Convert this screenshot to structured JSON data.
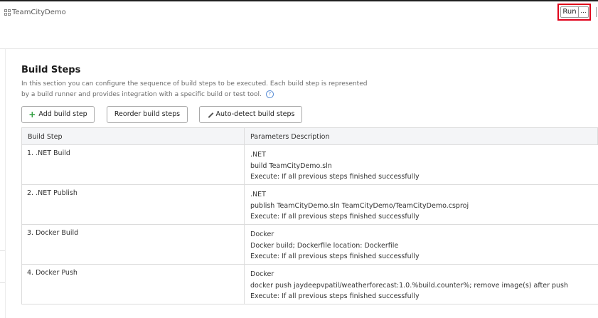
{
  "header": {
    "project_name": "TeamCityDemo",
    "run_label": "Run",
    "more_label": "..."
  },
  "section": {
    "title": "Build Steps",
    "description": "In this section you can configure the sequence of build steps to be executed. Each build step is represented by a build runner and provides integration with a specific build or test tool.",
    "help_glyph": "?"
  },
  "toolbar": {
    "add_label": "Add build step",
    "reorder_label": "Reorder build steps",
    "autodetect_label": "Auto-detect build steps"
  },
  "table": {
    "columns": [
      "Build Step",
      "Parameters Description"
    ],
    "rows": [
      {
        "step": "1. .NET Build",
        "params": [
          ".NET",
          "build TeamCityDemo.sln",
          "Execute: If all previous steps finished successfully"
        ]
      },
      {
        "step": "2. .NET Publish",
        "params": [
          ".NET",
          "publish TeamCityDemo.sln TeamCityDemo/TeamCityDemo.csproj",
          "Execute: If all previous steps finished successfully"
        ]
      },
      {
        "step": "3. Docker Build",
        "params": [
          "Docker",
          "Docker build; Dockerfile location: Dockerfile",
          "Execute: If all previous steps finished successfully"
        ]
      },
      {
        "step": "4. Docker Push",
        "params": [
          "Docker",
          "docker push jaydeepvpatil/weatherforecast:1.0.%build.counter%; remove image(s) after push",
          "Execute: If all previous steps finished successfully"
        ]
      }
    ]
  },
  "colors": {
    "highlight": "#e0001a",
    "add_icon": "#2e9e3e",
    "header_row": "#f4f5f7"
  },
  "icons": {
    "project": "grid-icon",
    "add": "plus-icon",
    "autodetect": "magic-wand-icon",
    "help": "question-circle-icon"
  }
}
